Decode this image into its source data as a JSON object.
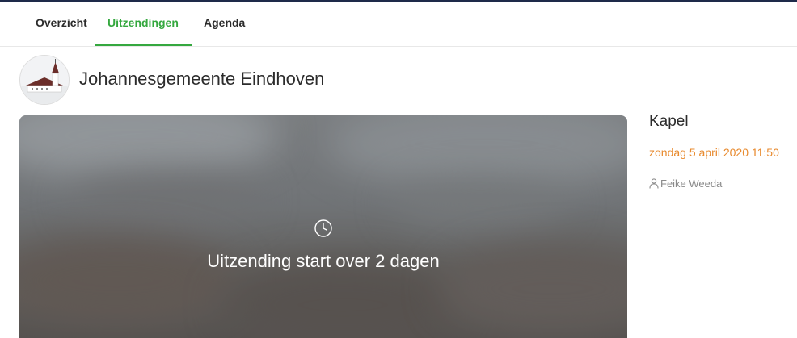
{
  "nav": {
    "tabs": [
      {
        "label": "Overzicht",
        "active": false
      },
      {
        "label": "Uitzendingen",
        "active": true
      },
      {
        "label": "Agenda",
        "active": false
      }
    ]
  },
  "channel": {
    "name": "Johannesgemeente Eindhoven",
    "avatar_icon": "church-icon"
  },
  "player": {
    "status_icon": "clock-icon",
    "status_text": "Uitzending start over 2 dagen"
  },
  "broadcast": {
    "location": "Kapel",
    "datetime": "zondag 5 april 2020 11:50",
    "person_icon": "person-icon",
    "person": "Feike Weeda"
  },
  "colors": {
    "accent": "#35a83f",
    "date": "#e88a2e",
    "top_rule": "#1e2a4a"
  }
}
